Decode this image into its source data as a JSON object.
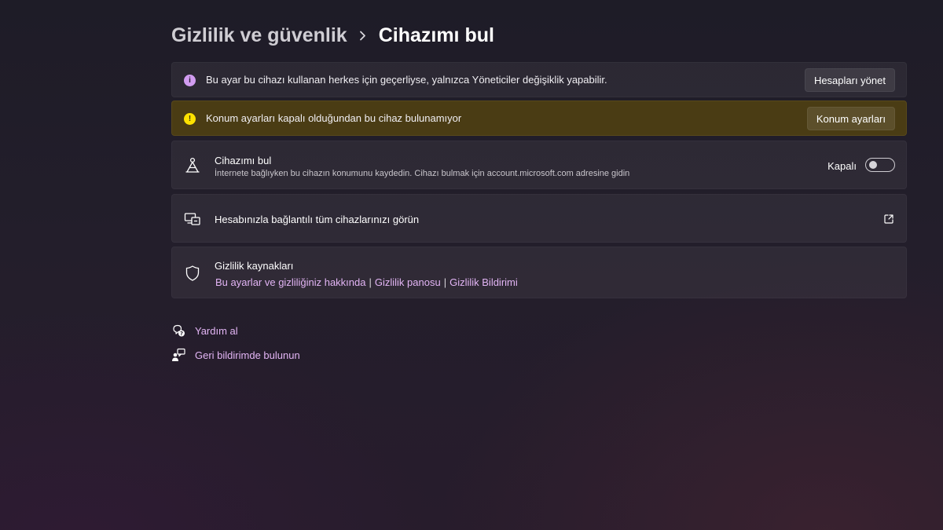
{
  "breadcrumb": {
    "parent": "Gizlilik ve güvenlik",
    "current": "Cihazımı bul"
  },
  "info_bar": {
    "icon": "info-icon",
    "text": "Bu ayar bu cihazı kullanan herkes için geçerliyse, yalnızca Yöneticiler değişiklik yapabilir.",
    "button": "Hesapları yönet"
  },
  "warning_bar": {
    "icon": "warning-icon",
    "text": "Konum ayarları kapalı olduğundan bu cihaz bulunamıyor",
    "button": "Konum ayarları"
  },
  "find_device": {
    "icon": "find-device-icon",
    "title": "Cihazımı bul",
    "description": "İnternete bağlıyken bu cihazın konumunu kaydedin. Cihazı bulmak için account.microsoft.com adresine gidin",
    "toggle_label": "Kapalı",
    "toggle_on": false
  },
  "devices": {
    "icon": "devices-icon",
    "title": "Hesabınızla bağlantılı tüm cihazlarınızı görün",
    "action_icon": "open-external-icon"
  },
  "privacy": {
    "icon": "shield-icon",
    "title": "Gizlilik kaynakları",
    "links": [
      "Bu ayarlar ve gizliliğiniz hakkında",
      "Gizlilik panosu",
      "Gizlilik Bildirimi"
    ]
  },
  "help_links": [
    {
      "icon": "help-icon",
      "label": "Yardım al"
    },
    {
      "icon": "feedback-icon",
      "label": "Geri bildirimde bulunun"
    }
  ],
  "colors": {
    "accent": "#e3b5f5",
    "info": "#d19cf0",
    "warning": "#fce100",
    "warning_bar_bg": "#4a3c14"
  }
}
